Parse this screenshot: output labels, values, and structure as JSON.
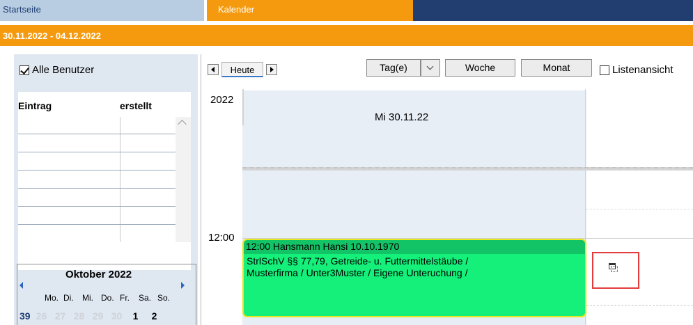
{
  "tabs": {
    "startseite": "Startseite",
    "kalender": "Kalender"
  },
  "date_range": "30.11.2022 - 04.12.2022",
  "left_panel": {
    "alle_benutzer_label": "Alle Benutzer",
    "alle_benutzer_checked": true,
    "table": {
      "headers": [
        "Eintrag",
        "erstellt"
      ]
    },
    "mini_calendar": {
      "month": "Oktober 2022",
      "weekdays": [
        "Mo.",
        "Di.",
        "Mi.",
        "Do.",
        "Fr.",
        "Sa.",
        "So."
      ],
      "week_number": "39",
      "days": [
        "26",
        "27",
        "28",
        "29",
        "30",
        "1",
        "2"
      ]
    }
  },
  "toolbar": {
    "heute": "Heute",
    "tag": "Tag(e)",
    "woche": "Woche",
    "monat": "Monat",
    "listenansicht": "Listenansicht",
    "listenansicht_checked": false
  },
  "calendar": {
    "year": "2022",
    "day_header": "Mi 30.11.22",
    "time_label": "12:00",
    "appointment": {
      "title": "12:00 Hansmann Hansi  10.10.1970",
      "line1": "StrlSchV §§ 77,79, Getreide- u. Futtermittelstäube /",
      "line2": "Musterfirma / Unter3Muster / Eigene Unteruchung /",
      "color": "#14f07a",
      "header_color": "#13c466",
      "border_color": "#e6e622"
    }
  },
  "colors": {
    "accent_orange": "#f59a0e",
    "navy": "#223d70",
    "highlight_red": "#e23b3b"
  }
}
